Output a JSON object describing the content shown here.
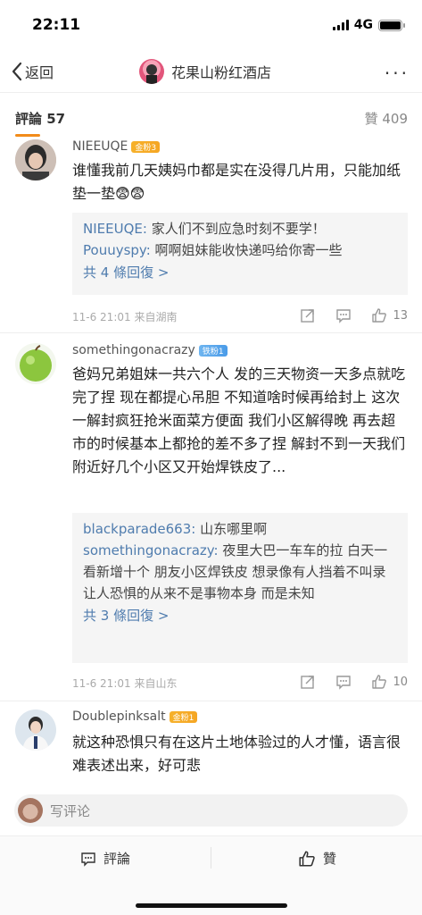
{
  "status_bar": {
    "time": "22:11",
    "network": "4G"
  },
  "nav": {
    "back_label": "返回",
    "title": "花果山粉红酒店",
    "more": "···"
  },
  "tabs": {
    "comments": "評論 57",
    "likes": "贊 409"
  },
  "comments": [
    {
      "username": "NIEEUQE",
      "badge": "金粉3",
      "text": "谁懂我前几天姨妈巾都是实在没得几片用，只能加纸垫一垫😨😨",
      "replies": [
        {
          "name": "NIEEUQE:",
          "text": " 家人们不到应急时刻不要学！"
        },
        {
          "name": "Pouuyspy:",
          "text": " 啊啊姐妹能收快递吗给你寄一些"
        }
      ],
      "more_replies": "共 4 條回復 >",
      "meta": "11-6 21:01  来自湖南",
      "likes": "13"
    },
    {
      "username": "somethingonacrazy",
      "badge": "铁粉1",
      "text": "爸妈兄弟姐妹一共六个人 发的三天物资一天多点就吃完了捏 现在都提心吊胆 不知道啥时候再给封上 这次一解封疯狂抢米面菜方便面 我们小区解得晚 再去超市的时候基本上都抢的差不多了捏 解封不到一天我们附近好几个小区又开始焊铁皮了...",
      "replies": [
        {
          "name": "blackparade663:",
          "text": " 山东哪里啊"
        },
        {
          "name": "somethingonacrazy:",
          "text": " 夜里大巴一车车的拉 白天一看新增十个 朋友小区焊铁皮 想录像有人挡着不叫录 让人恐惧的从来不是事物本身 而是未知"
        }
      ],
      "more_replies": "共 3 條回復 >",
      "meta": "11-6 21:01  来自山东",
      "likes": "10"
    },
    {
      "username": "Doublepinksalt",
      "badge": "金粉1",
      "text": "就这种恐惧只有在这片土地体验过的人才懂，语言很难表述出来，好可悲"
    }
  ],
  "input": {
    "placeholder": "写评论"
  },
  "bottom": {
    "comment": "評論",
    "like": "贊"
  },
  "colors": {
    "accent": "#f28b1a",
    "link": "#4f7cae"
  }
}
